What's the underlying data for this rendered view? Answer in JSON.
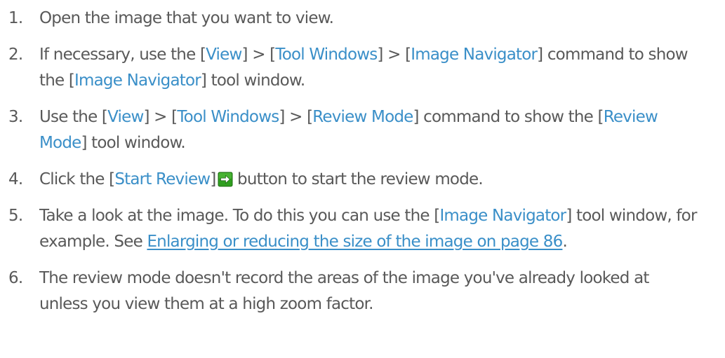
{
  "steps": [
    {
      "number": "1.",
      "text": "Open the image that you want to view."
    },
    {
      "number": "2.",
      "prefix": "If necessary, use the [",
      "ui1": "View",
      "sep1": "] > [",
      "ui2": "Tool Windows",
      "sep2": "] > [",
      "ui3": "Image Navigator",
      "mid": "] command to show the [",
      "ui4": "Image Navigator",
      "suffix": "] tool window."
    },
    {
      "number": "3.",
      "prefix": "Use the [",
      "ui1": "View",
      "sep1": "] > [",
      "ui2": "Tool Windows",
      "sep2": "] > [",
      "ui3": "Review Mode",
      "mid": "] command to show the [",
      "ui4": "Review Mode",
      "suffix": "] tool window."
    },
    {
      "number": "4.",
      "prefix": "Click the [",
      "ui1": "Start Review",
      "mid": "]",
      "icon": "start-review-arrow-icon",
      "suffix": " button to start the review mode."
    },
    {
      "number": "5.",
      "prefix": "Take a look at the image. To do this you can use the [",
      "ui1": "Image Navigator",
      "mid": "] tool window, for example. See ",
      "link": "Enlarging or reducing the size of the image on page 86",
      "suffix": "."
    },
    {
      "number": "6.",
      "text": "The review mode doesn't record the areas of the image you've already looked at unless you view them at a high zoom factor."
    }
  ],
  "colors": {
    "text": "#595959",
    "ui_term": "#3a8fc8",
    "icon_green": "#2f9e1f"
  }
}
